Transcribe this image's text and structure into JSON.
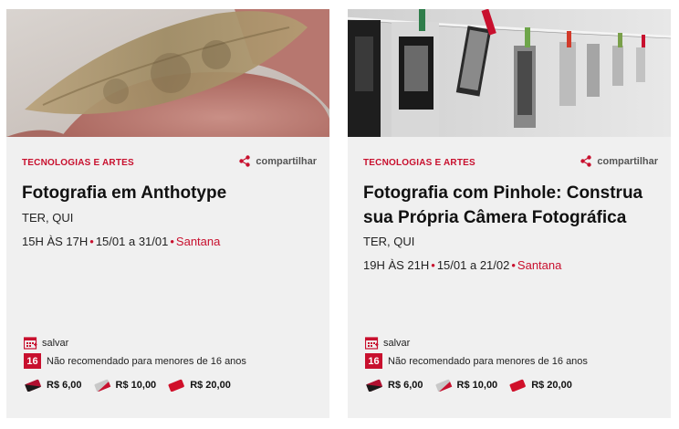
{
  "cards": [
    {
      "category": "TECNOLOGIAS E ARTES",
      "share_label": "compartilhar",
      "title": "Fotografia em Anthotype",
      "days": "TER, QUI",
      "time": "15H ÀS 17H",
      "dates": "15/01 a 31/01",
      "place": "Santana",
      "save_label": "salvar",
      "age_rating": "16",
      "age_text": "Não recomendado para menores de 16 anos",
      "prices": [
        "R$ 6,00",
        "R$ 10,00",
        "R$ 20,00"
      ]
    },
    {
      "category": "TECNOLOGIAS E ARTES",
      "share_label": "compartilhar",
      "title": "Fotografia com Pinhole: Construa sua Própria Câmera Fotográfica",
      "days": "TER, QUI",
      "time": "19H ÀS 21H",
      "dates": "15/01 a 21/02",
      "place": "Santana",
      "save_label": "salvar",
      "age_rating": "16",
      "age_text": "Não recomendado para menores de 16 anos",
      "prices": [
        "R$ 6,00",
        "R$ 10,00",
        "R$ 20,00"
      ]
    }
  ],
  "colors": {
    "accent": "#c8102e",
    "card_bg": "#f0f0f0"
  },
  "icons": [
    "share-icon",
    "calendar-save-icon",
    "ticket-icon"
  ]
}
